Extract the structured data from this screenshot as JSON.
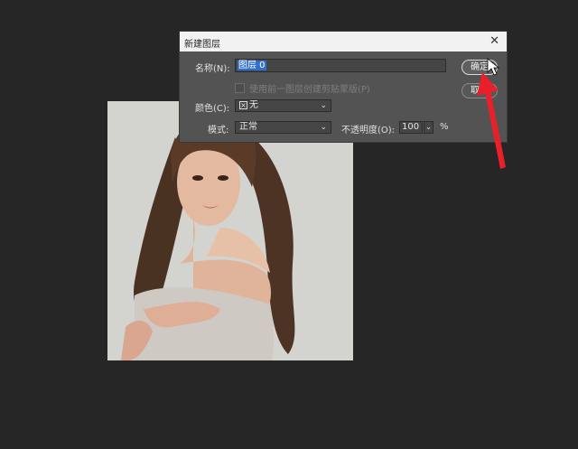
{
  "dialog": {
    "title": "新建图层",
    "close_icon": "close-icon",
    "name_label": "名称(N):",
    "name_value": "图层 0",
    "clip_label": "使用前一图层创建剪贴蒙版(P)",
    "clip_checked": false,
    "color_label": "颜色(C):",
    "color_value": "无",
    "mode_label": "模式:",
    "mode_value": "正常",
    "opacity_label": "不透明度(O):",
    "opacity_value": "100",
    "opacity_unit": "%",
    "ok_label": "确定",
    "cancel_label": "取消"
  },
  "colors": {
    "background": "#262626",
    "dialog": "#535353",
    "selection": "#2f6fd0",
    "arrow": "#e8202a"
  },
  "annotation": {
    "icon": "red-arrow-icon",
    "pointer": "cursor-icon"
  }
}
